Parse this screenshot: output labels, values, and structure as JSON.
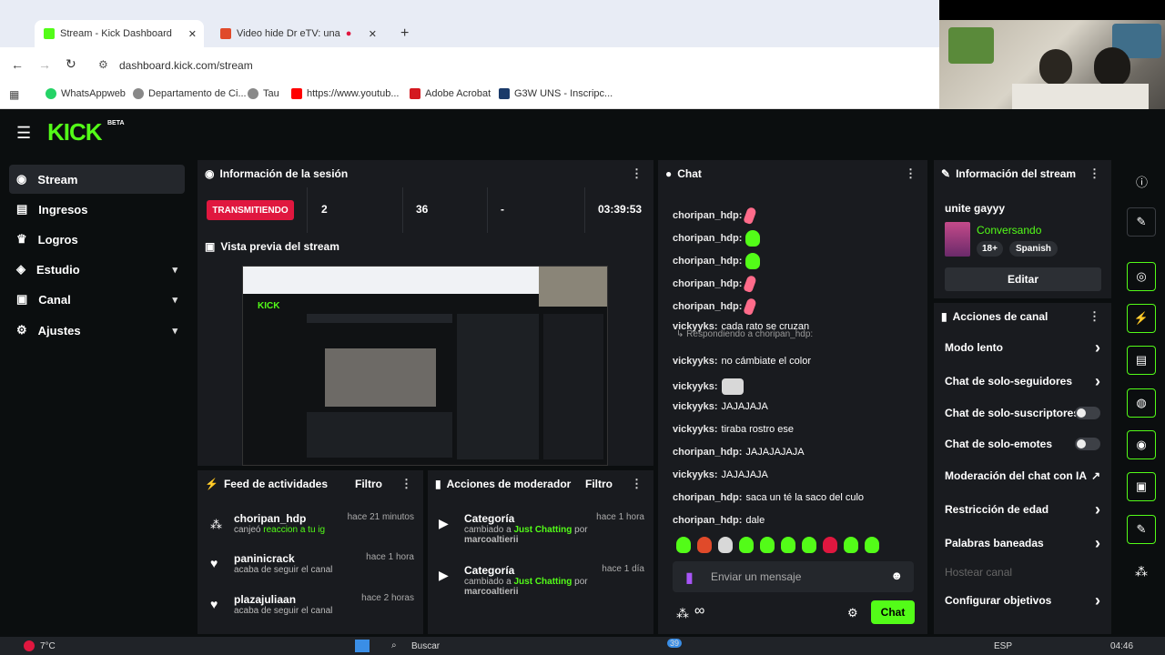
{
  "browser": {
    "tabs": [
      {
        "label": "Stream - Kick Dashboard"
      },
      {
        "label": "Video hide Dr eTV: una"
      }
    ],
    "url": "dashboard.kick.com/stream",
    "bookmarks": [
      "WhatsAppweb",
      "Departamento de Ci...",
      "Tau",
      "https://www.youtub...",
      "Adobe Acrobat",
      "G3W UNS - Inscripc..."
    ]
  },
  "sidebar": {
    "logo": "KICK",
    "logo_badge": "BETA",
    "items": [
      {
        "label": "Stream",
        "icon": "broadcast-icon"
      },
      {
        "label": "Ingresos",
        "icon": "chart-icon"
      },
      {
        "label": "Logros",
        "icon": "trophy-icon"
      },
      {
        "label": "Estudio",
        "icon": "layers-icon"
      },
      {
        "label": "Canal",
        "icon": "person-icon"
      },
      {
        "label": "Ajustes",
        "icon": "gear-icon"
      }
    ]
  },
  "session": {
    "title": "Información de la sesión",
    "status": "TRANSMITIENDO",
    "stats": [
      "2",
      "36",
      "-"
    ],
    "duration": "03:39:53"
  },
  "preview": {
    "title": "Vista previa del stream"
  },
  "feed": {
    "title": "Feed de actividades",
    "filter": "Filtro",
    "items": [
      {
        "name": "choripan_hdp",
        "text": "canjeó",
        "highlight": "reaccion a tu ig",
        "time": "hace 21 minutos"
      },
      {
        "name": "paninicrack",
        "text": "acaba de seguir el canal",
        "time": "hace 1 hora"
      },
      {
        "name": "plazajuliaan",
        "text": "acaba de seguir el canal",
        "time": "hace 2 horas"
      }
    ]
  },
  "mod": {
    "title": "Acciones de moderador",
    "filter": "Filtro",
    "items": [
      {
        "name": "Categoría",
        "pre": "cambiado a",
        "highlight": "Just Chatting",
        "post": "por",
        "by": "marcoaltierii",
        "time": "hace 1 hora"
      },
      {
        "name": "Categoría",
        "pre": "cambiado a",
        "highlight": "Just Chatting",
        "post": "por",
        "by": "marcoaltierii",
        "time": "hace 1 día"
      }
    ]
  },
  "chat": {
    "title": "Chat",
    "messages": [
      {
        "user": "choripan_hdp:",
        "text": "",
        "emote": "pink"
      },
      {
        "user": "choripan_hdp:",
        "text": "",
        "emote": "green"
      },
      {
        "user": "choripan_hdp:",
        "text": "",
        "emote": "green"
      },
      {
        "user": "choripan_hdp:",
        "text": "",
        "emote": "pink"
      },
      {
        "user": "choripan_hdp:",
        "text": "",
        "emote": "pink"
      },
      {
        "user": "vickyyks:",
        "text": "cada rato se cruzan",
        "emote": ""
      },
      {
        "user": "vickyyks:",
        "text": "no cámbiate el color",
        "emote": ""
      },
      {
        "user": "vickyyks:",
        "text": "",
        "emote": "cat"
      },
      {
        "user": "vickyyks:",
        "text": "JAJAJAJA",
        "emote": ""
      },
      {
        "user": "vickyyks:",
        "text": "tiraba rostro ese",
        "emote": ""
      },
      {
        "user": "choripan_hdp:",
        "text": "JAJAJAJAJA",
        "emote": ""
      },
      {
        "user": "vickyyks:",
        "text": "JAJAJAJA",
        "emote": ""
      },
      {
        "user": "choripan_hdp:",
        "text": "saca un té la saco del culo",
        "emote": ""
      },
      {
        "user": "choripan_hdp:",
        "text": "dale",
        "emote": ""
      }
    ],
    "reply": "Respondiendo a choripan_hdp:",
    "placeholder": "Enviar un mensaje",
    "send": "Chat",
    "infinity": "∞"
  },
  "stream_info": {
    "title": "Información del stream",
    "stream_title": "unite gayyy",
    "category": "Conversando",
    "tags": [
      "18+",
      "Spanish"
    ],
    "edit": "Editar"
  },
  "channel_actions": {
    "title": "Acciones de canal",
    "items": [
      {
        "label": "Modo lento",
        "control": "arrow"
      },
      {
        "label": "Chat de solo-seguidores",
        "control": "arrow"
      },
      {
        "label": "Chat de solo-suscriptores",
        "control": "toggle"
      },
      {
        "label": "Chat de solo-emotes",
        "control": "toggle"
      },
      {
        "label": "Moderación del chat con IA",
        "control": "link"
      },
      {
        "label": "Restricción de edad",
        "control": "arrow"
      },
      {
        "label": "Palabras baneadas",
        "control": "arrow"
      },
      {
        "label": "Hostear canal",
        "control": "none"
      },
      {
        "label": "Configurar objetivos",
        "control": "arrow"
      }
    ]
  },
  "taskbar": {
    "weather": "7°C",
    "search": "Buscar",
    "lang": "ESP",
    "time": "04:46",
    "badge": "39"
  },
  "colors": {
    "accent": "#53fc18",
    "live": "#e0173f"
  }
}
